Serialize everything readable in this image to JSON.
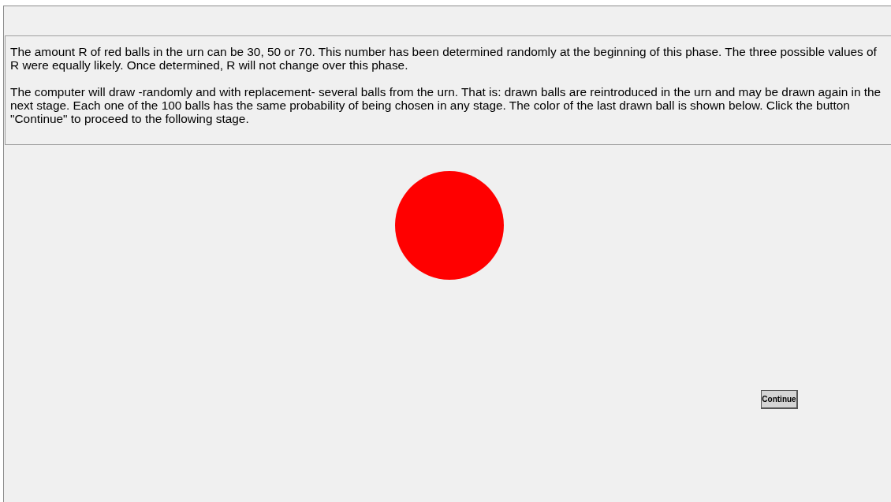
{
  "instructions": {
    "paragraphs": [
      "The amount R of red balls in the urn can be 30, 50 or 70. This number has been determined randomly at the beginning of this phase. The three possible values of R were equally likely. Once determined, R will not change over this phase.",
      "The computer will draw -randomly and with replacement- several balls from the urn. That is: drawn balls are reintroduced in the urn and may be drawn again in the next stage. Each one of the 100 balls has the same probability of being chosen in any stage. The color of the last drawn ball is shown below. Click the button \"Continue\" to proceed to the following stage."
    ]
  },
  "ball": {
    "color": "#ff0000"
  },
  "buttons": [
    "Continue"
  ]
}
